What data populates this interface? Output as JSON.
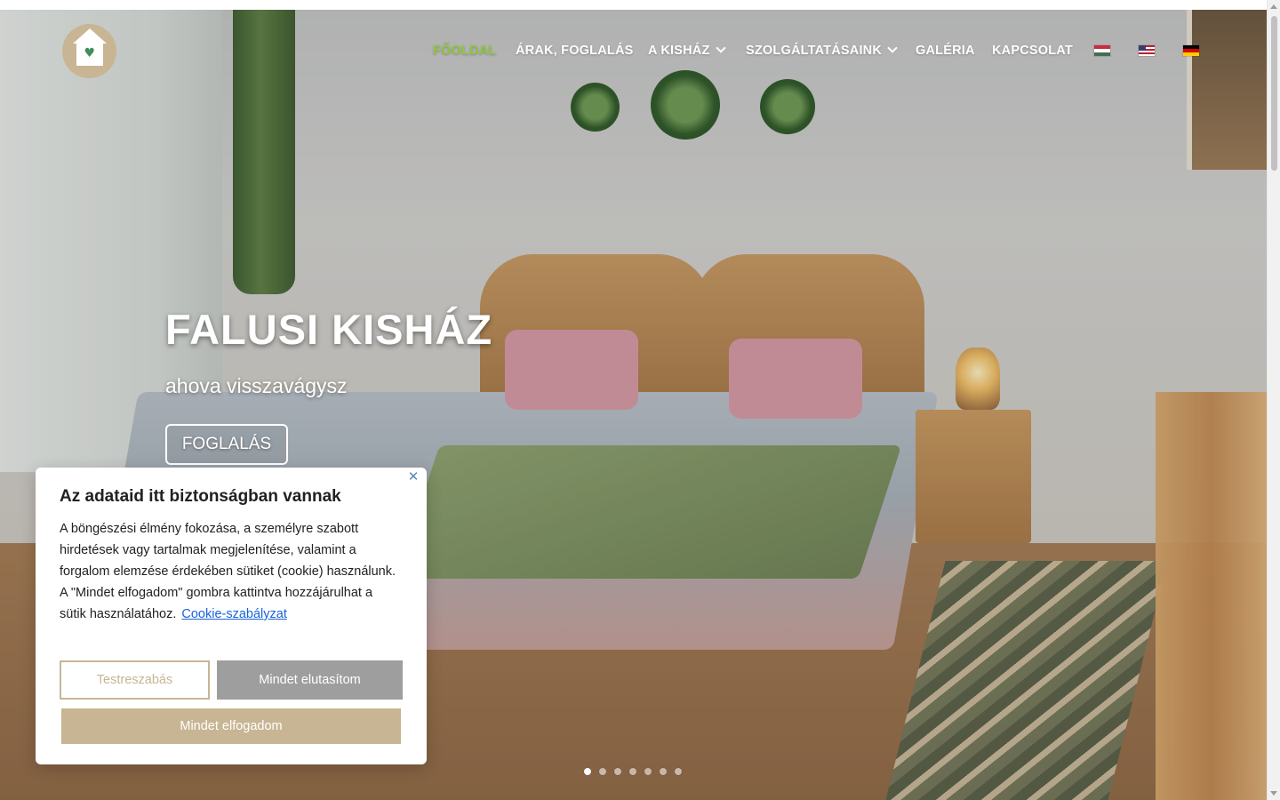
{
  "nav": {
    "items": [
      {
        "label": "FŐOLDAL",
        "active": true
      },
      {
        "label": "ÁRAK, FOGLALÁS"
      },
      {
        "label": "A KISHÁZ",
        "has_dropdown": true
      },
      {
        "label": "SZOLGÁLTATÁSAINK",
        "has_dropdown": true
      },
      {
        "label": "GALÉRIA"
      },
      {
        "label": "KAPCSOLAT"
      }
    ],
    "active_color": "#8dc63f",
    "flags": [
      "hungarian-flag-icon",
      "us-flag-icon",
      "german-flag-icon"
    ]
  },
  "hero": {
    "title": "FALUSI KISHÁZ",
    "subtitle": "ahova visszavágysz",
    "button": "FOGLALÁS"
  },
  "slider": {
    "total": 7,
    "active_index": 0
  },
  "cookie": {
    "title": "Az adataid itt biztonságban vannak",
    "text": "A böngészési élmény fokozása, a személyre szabott hirdetések vagy tartalmak megjelenítése, valamint a forgalom elemzése érdekében sütiket (cookie) használunk. A \"Mindet elfogadom\" gombra kattintva hozzájárulhat a sütik használatához.",
    "link": "Cookie-szabályzat",
    "btn_customize": "Testreszabás",
    "btn_reject": "Mindet elutasítom",
    "btn_accept": "Mindet elfogadom",
    "accent_color": "#c8b593"
  }
}
